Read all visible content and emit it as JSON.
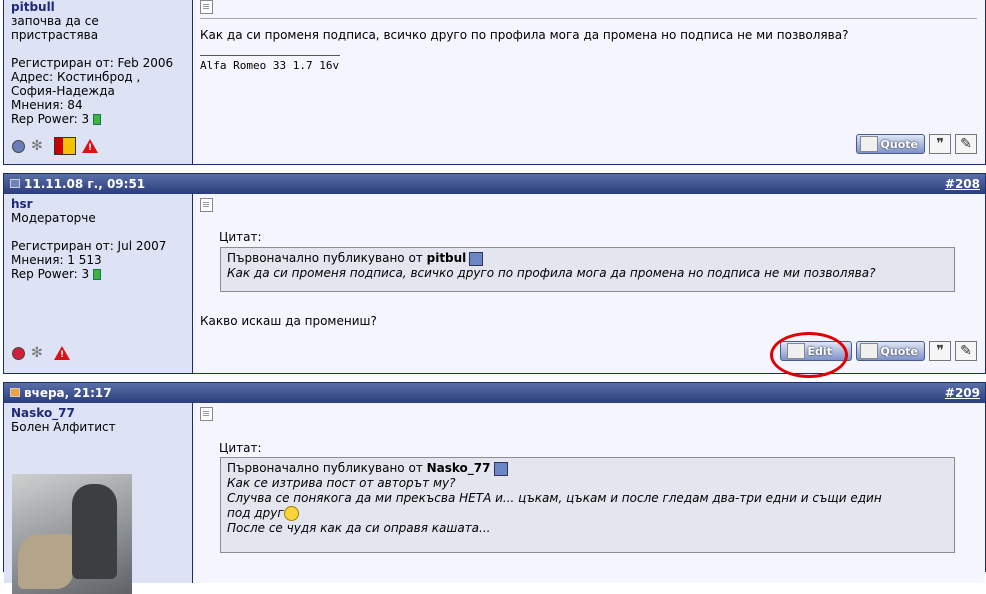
{
  "post207": {
    "username": "pitbull",
    "user_title": "започва да се пристрастява",
    "registered": "Регистриран от: Feb 2006",
    "address_1": "Адрес: Костинброд ,",
    "address_2": "София-Надежда",
    "posts": "Мнения: 84",
    "rep_power": "Rep Power: 3",
    "message": "Как да си променя подписа, всичко друго по профила мога да промена но подписа не ми позволява?",
    "signature": "Alfa Romeo 33 1.7 16v"
  },
  "post208": {
    "date": "11.11.08 г., 09:51",
    "number": "#208",
    "username": "hsr",
    "user_title": "Модераторче",
    "registered": "Регистриран от: Jul 2007",
    "posts": "Мнения: 1 513",
    "rep_power": "Rep Power: 3",
    "quote_label": "Цитат:",
    "quote_intro": "Първоначално публикувано от",
    "quote_author": "pitbul",
    "quote_text": "Как да си променя подписа, всичко друго по профила мога да промена но подписа не ми позволява?",
    "message": "Какво искаш да промениш?"
  },
  "post209": {
    "date": "вчера, 21:17",
    "number": "#209",
    "username": "Nasko_77",
    "user_title": "Болен Алфитист",
    "quote_label": "Цитат:",
    "quote_intro": "Първоначално публикувано от",
    "quote_author": "Nasko_77",
    "quote_line1": "Как се изтрива пост от авторът му?",
    "quote_line2": "Случва се понякога да ми прекъсва НЕТА и... цъкам, цъкам и после гледам два-три едни и същи един",
    "quote_line3": "под друг",
    "quote_line4": "После се чудя как да си оправя кашата..."
  },
  "buttons": {
    "quote": "Quote",
    "edit": "Edit"
  },
  "colors": {
    "header": "#2b3e7c",
    "user_panel": "#dde3f4",
    "highlight": "#e00000"
  }
}
